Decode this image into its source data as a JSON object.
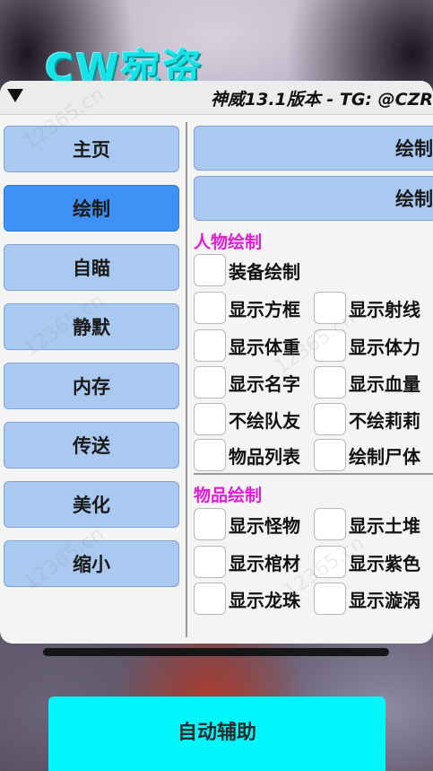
{
  "logo_text": "CW宛资",
  "header": {
    "title": "神威13.1版本 - TG: @CZR"
  },
  "sidebar": {
    "items": [
      {
        "label": "主页"
      },
      {
        "label": "绘制"
      },
      {
        "label": "自瞄"
      },
      {
        "label": "静默"
      },
      {
        "label": "内存"
      },
      {
        "label": "传送"
      },
      {
        "label": "美化"
      },
      {
        "label": "缩小"
      }
    ],
    "active_index": 1
  },
  "tabs": [
    {
      "label": "绘制"
    },
    {
      "label": "绘制"
    }
  ],
  "person_section": {
    "title": "人物绘制",
    "items": [
      "装备绘制",
      "显示方框",
      "显示射线",
      "显示体重",
      "显示体力",
      "显示名字",
      "显示血量",
      "不绘队友",
      "不绘莉莉",
      "物品列表",
      "绘制尸体"
    ]
  },
  "item_section": {
    "title": "物品绘制",
    "items": [
      "显示怪物",
      "显示土堆",
      "显示棺材",
      "显示紫色",
      "显示龙珠",
      "显示漩涡"
    ]
  },
  "bottom_button": {
    "label": "自动辅助"
  },
  "watermark_text": "12365.cn",
  "colors": {
    "nav_bg": "#a9c9f1",
    "nav_active": "#3f91f5",
    "section_title": "#e11bd6",
    "logo": "#16e3e8",
    "auto_button": "#00f7fb"
  }
}
